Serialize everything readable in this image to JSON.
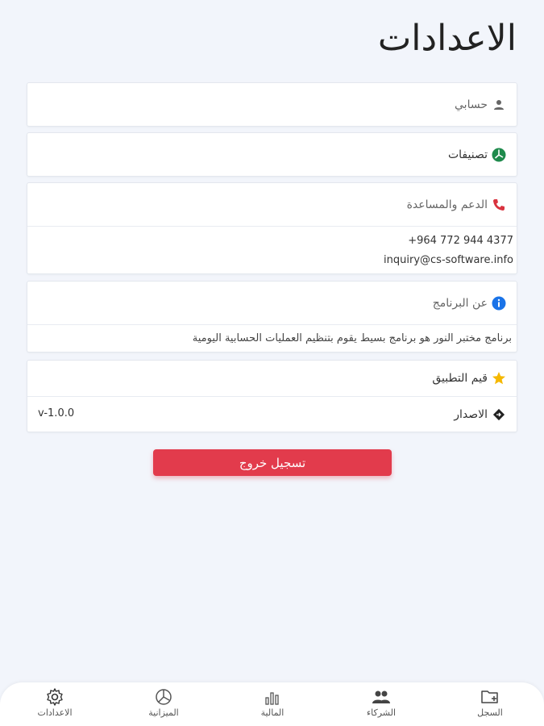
{
  "header": {
    "title": "الاعدادات"
  },
  "account": {
    "label": "حسابي",
    "icon": "user-icon"
  },
  "categories": {
    "label": "تصنيفات",
    "icon": "pie-chart-icon"
  },
  "support": {
    "label": "الدعم والمساعدة",
    "icon": "phone-icon",
    "phone": "+964 772 944 4377",
    "email": "inquiry@cs-software.info"
  },
  "about": {
    "label": "عن البرنامج",
    "icon": "info-icon",
    "description": "برنامج مختبر النور هو برنامج بسيط يقوم بتنظيم العمليات الحسابية اليومية"
  },
  "rate": {
    "label": "قيم التطبيق",
    "icon": "star-icon"
  },
  "version": {
    "label": "الاصدار",
    "icon": "diamond-arrow-icon",
    "value": "v-1.0.0"
  },
  "logout_label": "تسجيل خروج",
  "tabs": [
    {
      "label": "الاعدادات",
      "icon": "gear-icon"
    },
    {
      "label": "الميزانية",
      "icon": "pie-chart-icon"
    },
    {
      "label": "المالية",
      "icon": "bar-chart-icon"
    },
    {
      "label": "الشركاء",
      "icon": "users-icon"
    },
    {
      "label": "السجل",
      "icon": "folder-plus-icon"
    }
  ],
  "colors": {
    "accent_red": "#e23b4c",
    "category_green": "#1e8a4c",
    "phone_red": "#d9333f",
    "info_blue": "#1a73e8",
    "star_yellow": "#f5b800",
    "background": "#f2f5fb"
  }
}
